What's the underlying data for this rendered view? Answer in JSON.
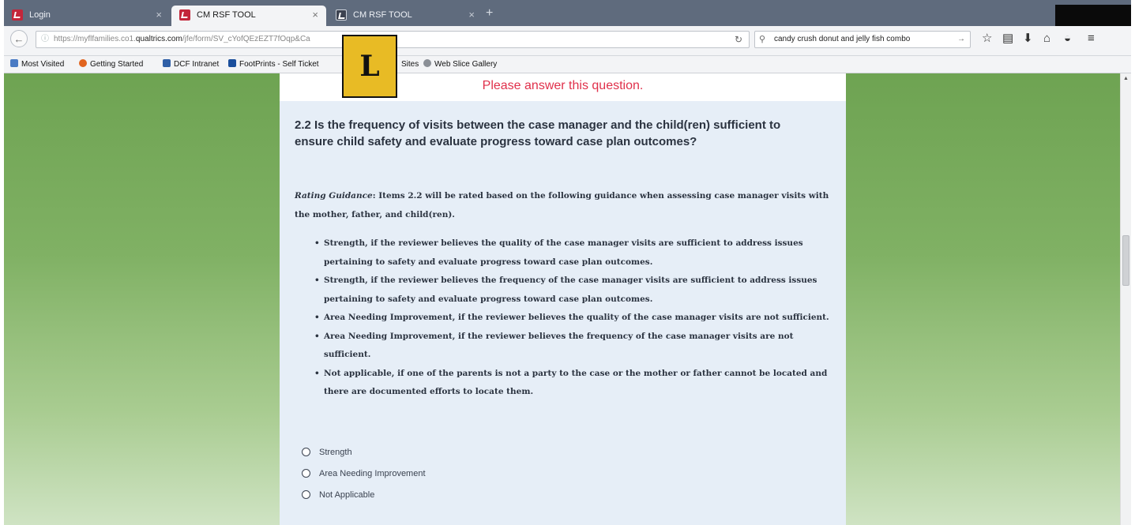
{
  "browser": {
    "tabs": [
      {
        "label": "Login",
        "active": false
      },
      {
        "label": "CM RSF TOOL",
        "active": true
      },
      {
        "label": "CM RSF TOOL",
        "active": false
      }
    ],
    "new_tab_icon": "plus-icon",
    "url": {
      "prefix": "https://myflfamilies.co1.",
      "domain": "qualtrics.com",
      "path": "/jfe/form/SV_cYofQEzEZT7fOqp&Ca"
    },
    "search_text": "candy crush donut and jelly fish combo",
    "bookmarks": [
      "Most Visited",
      "Getting Started",
      "DCF Intranet",
      "FootPrints - Self Ticket",
      "Sites",
      "Web Slice Gallery"
    ]
  },
  "overlay_badge": "L",
  "form": {
    "error_message": "Please answer this question.",
    "question": "2.2  Is the frequency of visits between the case manager and the child(ren) sufficient to ensure child safety and evaluate progress toward case plan outcomes?",
    "guidance_label": "Rating Guidance",
    "guidance_text": ": Items 2.2 will be rated based on the following guidance when assessing case manager visits with the mother, father, and child(ren).",
    "bullets": [
      "Strength, if the reviewer believes the quality of the case manager visits are sufficient to address issues pertaining to safety and evaluate progress toward case plan outcomes.",
      "Strength, if the reviewer believes the frequency of the case manager visits are sufficient to address issues pertaining to safety and evaluate progress toward case plan outcomes.",
      "Area Needing Improvement, if the reviewer believes the quality of the case manager visits are not sufficient.",
      "Area Needing Improvement, if the reviewer believes the frequency of the case manager visits are not sufficient.",
      "Not applicable, if one of the parents is not a party to the case or the mother or father cannot be located and there are documented efforts to locate them."
    ],
    "choices": [
      "Strength",
      "Area Needing Improvement",
      "Not Applicable"
    ]
  },
  "colors": {
    "error": "#e0304b",
    "panel": "#e6eef7",
    "background_top": "#6ea352",
    "badge": "#e8bb25"
  }
}
